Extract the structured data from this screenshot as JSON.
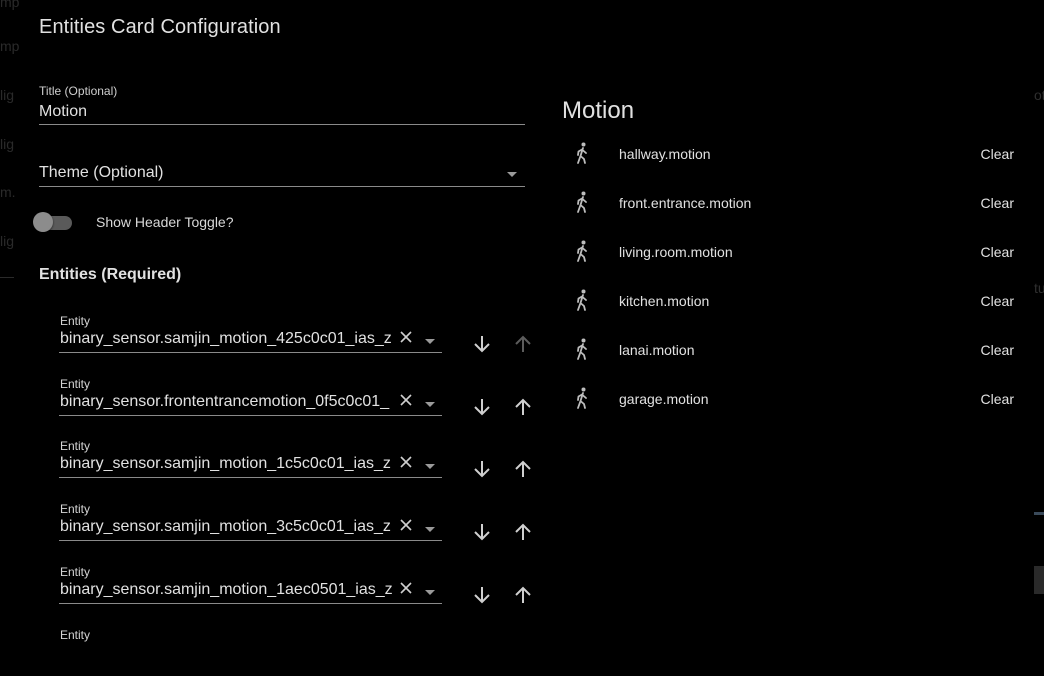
{
  "background": {
    "left_fragments": [
      "mp",
      "mp",
      "lig",
      "lig",
      "m.",
      "lig"
    ],
    "right_fragments": [
      "ot",
      "tu"
    ]
  },
  "dialog": {
    "title": "Entities Card Configuration",
    "title_field": {
      "label": "Title (Optional)",
      "value": "Motion"
    },
    "theme_field": {
      "placeholder": "Theme (Optional)"
    },
    "header_toggle": {
      "label": "Show Header Toggle?",
      "checked": false
    },
    "entities_heading": "Entities (Required)",
    "entity_label": "Entity",
    "entities": [
      {
        "value": "binary_sensor.samjin_motion_425c0c01_ias_z",
        "up_enabled": false
      },
      {
        "value": "binary_sensor.frontentrancemotion_0f5c0c01_",
        "up_enabled": true
      },
      {
        "value": "binary_sensor.samjin_motion_1c5c0c01_ias_z",
        "up_enabled": true
      },
      {
        "value": "binary_sensor.samjin_motion_3c5c0c01_ias_z",
        "up_enabled": true
      },
      {
        "value": "binary_sensor.samjin_motion_1aec0501_ias_z",
        "up_enabled": true
      }
    ]
  },
  "preview": {
    "title": "Motion",
    "icon": "walk-icon",
    "rows": [
      {
        "name": "hallway.motion",
        "state": "Clear"
      },
      {
        "name": "front.entrance.motion",
        "state": "Clear"
      },
      {
        "name": "living.room.motion",
        "state": "Clear"
      },
      {
        "name": "kitchen.motion",
        "state": "Clear"
      },
      {
        "name": "lanai.motion",
        "state": "Clear"
      },
      {
        "name": "garage.motion",
        "state": "Clear"
      }
    ]
  },
  "colors": {
    "background": "#000000",
    "text": "#e1e1e1",
    "underline": "#8a8a8a",
    "disabled_icon": "#5c5c5c"
  }
}
